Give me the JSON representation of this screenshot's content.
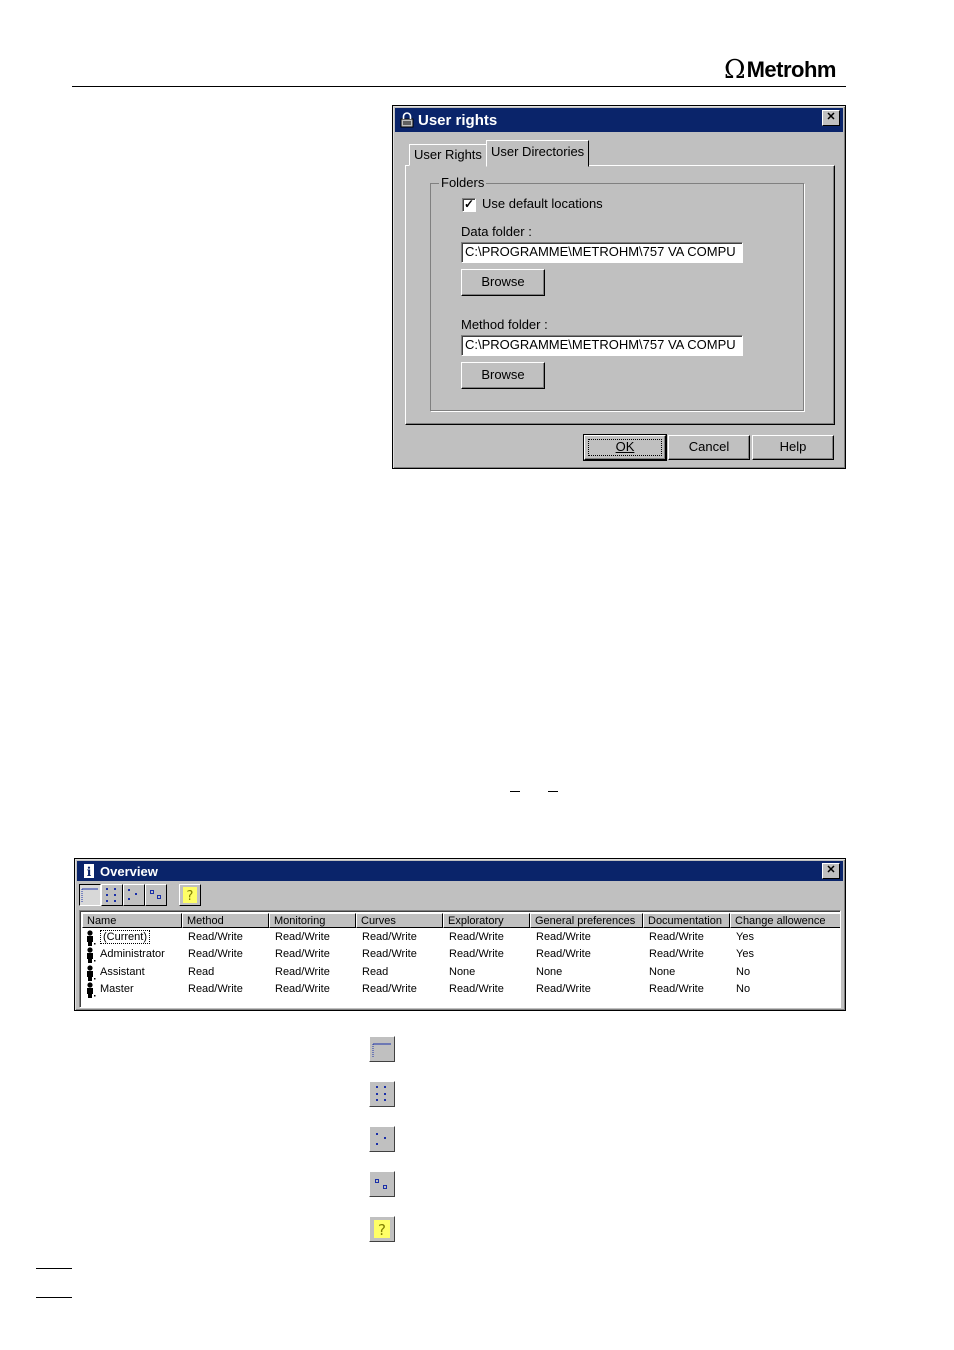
{
  "header": {
    "brand": "Metrohm",
    "brand_symbol": "Ω"
  },
  "user_rights_dialog": {
    "title": "User rights",
    "close_glyph": "✕",
    "tabs": [
      {
        "label": "User Rights",
        "active": false
      },
      {
        "label": "User Directories",
        "active": true
      }
    ],
    "folders_group_label": "Folders",
    "use_default_locations": {
      "label": "Use default locations",
      "checked": true
    },
    "data_folder": {
      "label": "Data folder :",
      "value": "C:\\PROGRAMME\\METROHM\\757 VA COMPU",
      "browse_label": "Browse"
    },
    "method_folder": {
      "label": "Method folder :",
      "value": "C:\\PROGRAMME\\METROHM\\757 VA COMPU",
      "browse_label": "Browse"
    },
    "buttons": {
      "ok": "OK",
      "cancel": "Cancel",
      "help": "Help"
    }
  },
  "overview_window": {
    "title": "Overview",
    "close_glyph": "✕",
    "toolbar_icons": [
      "details-view-icon",
      "large-icons-view-icon",
      "small-icons-view-icon",
      "list-view-icon",
      "help-icon"
    ],
    "columns": [
      "Name",
      "Method",
      "Monitoring",
      "Curves",
      "Exploratory",
      "General preferences",
      "Documentation",
      "Change allowence"
    ],
    "rows": [
      [
        "(Current)",
        "Read/Write",
        "Read/Write",
        "Read/Write",
        "Read/Write",
        "Read/Write",
        "Read/Write",
        "Yes"
      ],
      [
        "Administrator",
        "Read/Write",
        "Read/Write",
        "Read/Write",
        "Read/Write",
        "Read/Write",
        "Read/Write",
        "Yes"
      ],
      [
        "Assistant",
        "Read",
        "Read/Write",
        "Read",
        "None",
        "None",
        "None",
        "No"
      ],
      [
        "Master",
        "Read/Write",
        "Read/Write",
        "Read/Write",
        "Read/Write",
        "Read/Write",
        "Read/Write",
        "No"
      ]
    ]
  },
  "legend_icons": [
    "details-view-icon",
    "large-icons-view-icon",
    "small-icons-view-icon",
    "list-view-icon",
    "help-icon"
  ],
  "colors": {
    "titlebar": "#0a246a",
    "face": "#c0c0c0",
    "icon_blue": "#1a2fa8",
    "help_yellow": "#ffff66"
  }
}
